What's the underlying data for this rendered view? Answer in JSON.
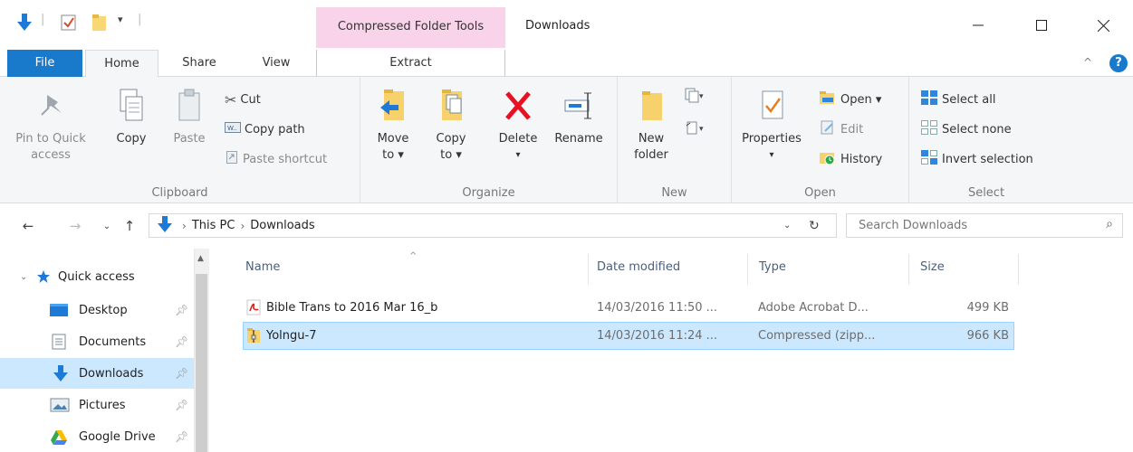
{
  "window": {
    "title": "Downloads",
    "context_tab_group": "Compressed Folder Tools",
    "minimize_glyph": "—",
    "maximize_glyph": "☐",
    "close_glyph": "✕"
  },
  "tabs": {
    "file": "File",
    "home": "Home",
    "share": "Share",
    "view": "View",
    "extract": "Extract"
  },
  "ribbon": {
    "clipboard": {
      "label": "Clipboard",
      "pin_line1": "Pin to Quick",
      "pin_line2": "access",
      "copy": "Copy",
      "paste": "Paste",
      "cut": "Cut",
      "copy_path": "Copy path",
      "paste_shortcut": "Paste shortcut"
    },
    "organize": {
      "label": "Organize",
      "move_line1": "Move",
      "move_line2": "to ▾",
      "copy_line1": "Copy",
      "copy_line2": "to ▾",
      "delete": "Delete",
      "delete_arrow": "▾",
      "rename": "Rename"
    },
    "new": {
      "label": "New",
      "new_line1": "New",
      "new_line2": "folder"
    },
    "open": {
      "label": "Open",
      "properties": "Properties",
      "properties_arrow": "▾",
      "open": "Open ▾",
      "edit": "Edit",
      "history": "History"
    },
    "select": {
      "label": "Select",
      "select_all": "Select all",
      "select_none": "Select none",
      "invert": "Invert selection"
    }
  },
  "address": {
    "crumbs": [
      "This PC",
      "Downloads"
    ],
    "search_placeholder": "Search Downloads"
  },
  "navpane": {
    "quick_access": "Quick access",
    "items": [
      {
        "label": "Desktop",
        "icon": "desktop-icon"
      },
      {
        "label": "Documents",
        "icon": "documents-icon"
      },
      {
        "label": "Downloads",
        "icon": "downloads-icon"
      },
      {
        "label": "Pictures",
        "icon": "pictures-icon"
      },
      {
        "label": "Google Drive",
        "icon": "google-drive-icon"
      }
    ]
  },
  "list": {
    "columns": [
      "Name",
      "Date modified",
      "Type",
      "Size"
    ],
    "rows": [
      {
        "name": "Bible Trans to 2016 Mar 16_b",
        "date": "14/03/2016 11:50 ...",
        "type": "Adobe Acrobat D...",
        "size": "499 KB",
        "icon": "pdf-icon"
      },
      {
        "name": "Yolngu-7",
        "date": "14/03/2016 11:24 ...",
        "type": "Compressed (zipp...",
        "size": "966 KB",
        "icon": "zip-icon"
      }
    ]
  },
  "colors": {
    "accent": "#1979ca",
    "context_pink": "#f9d3e9",
    "selection": "#cce8ff",
    "delete_red": "#e81123"
  }
}
